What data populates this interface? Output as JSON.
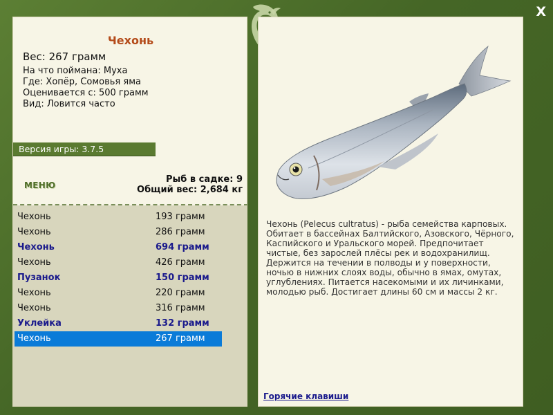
{
  "close_label": "X",
  "fish_card": {
    "title": "Чехонь",
    "weight": "Вес: 267 грамм",
    "caught_on": "На что поймана: Муха",
    "location": "Где: Хопёр, Сомовья яма",
    "valued_from": "Оценивается с: 500 грамм",
    "species_status": "Вид: Ловится часто"
  },
  "version": "Версия игры: 3.7.5",
  "menu_label": "МЕНЮ",
  "keepnet": {
    "count": "Рыб в садке: 9",
    "total_weight": "Общий вес: 2,684 кг"
  },
  "catch_list": [
    {
      "name": "Чехонь",
      "weight": "193 грамм",
      "bold": false,
      "selected": false
    },
    {
      "name": "Чехонь",
      "weight": "286 грамм",
      "bold": false,
      "selected": false
    },
    {
      "name": "Чехонь",
      "weight": "694 грамм",
      "bold": true,
      "selected": false
    },
    {
      "name": "Чехонь",
      "weight": "426 грамм",
      "bold": false,
      "selected": false
    },
    {
      "name": "Пузанок",
      "weight": "150 грамм",
      "bold": true,
      "selected": false
    },
    {
      "name": "Чехонь",
      "weight": "220 грамм",
      "bold": false,
      "selected": false
    },
    {
      "name": "Чехонь",
      "weight": "316 грамм",
      "bold": false,
      "selected": false
    },
    {
      "name": "Уклейка",
      "weight": "132 грамм",
      "bold": true,
      "selected": false
    },
    {
      "name": "Чехонь",
      "weight": "267 грамм",
      "bold": false,
      "selected": true
    }
  ],
  "description": "Чехонь (Pelecus cultratus) - рыба семейства карповых. Обитает в бассейнах Балтийского, Азовского, Чёрного, Каспийского и Уральского морей. Предпочитает чистые, без зарослей плёсы рек и водохранилищ. Держится на течении в полводы и у поверхности, ночью в нижних слоях воды, обычно в ямах, омутах, углублениях. Питается насекомыми и их личинками, молодью рыб. Достигает длины 60 см и массы 2 кг.",
  "hotkeys_link": "Горячие клавиши",
  "colors": {
    "frame": "#4a6a2c",
    "panel": "#f7f5e6",
    "title": "#b44b1a",
    "bold_row": "#1a1a8c",
    "selected_row": "#0a7bd8"
  },
  "icons": {
    "logo": "leaping-fish-logo",
    "close": "close-icon",
    "fish_image": "sabre-carp-fish"
  }
}
